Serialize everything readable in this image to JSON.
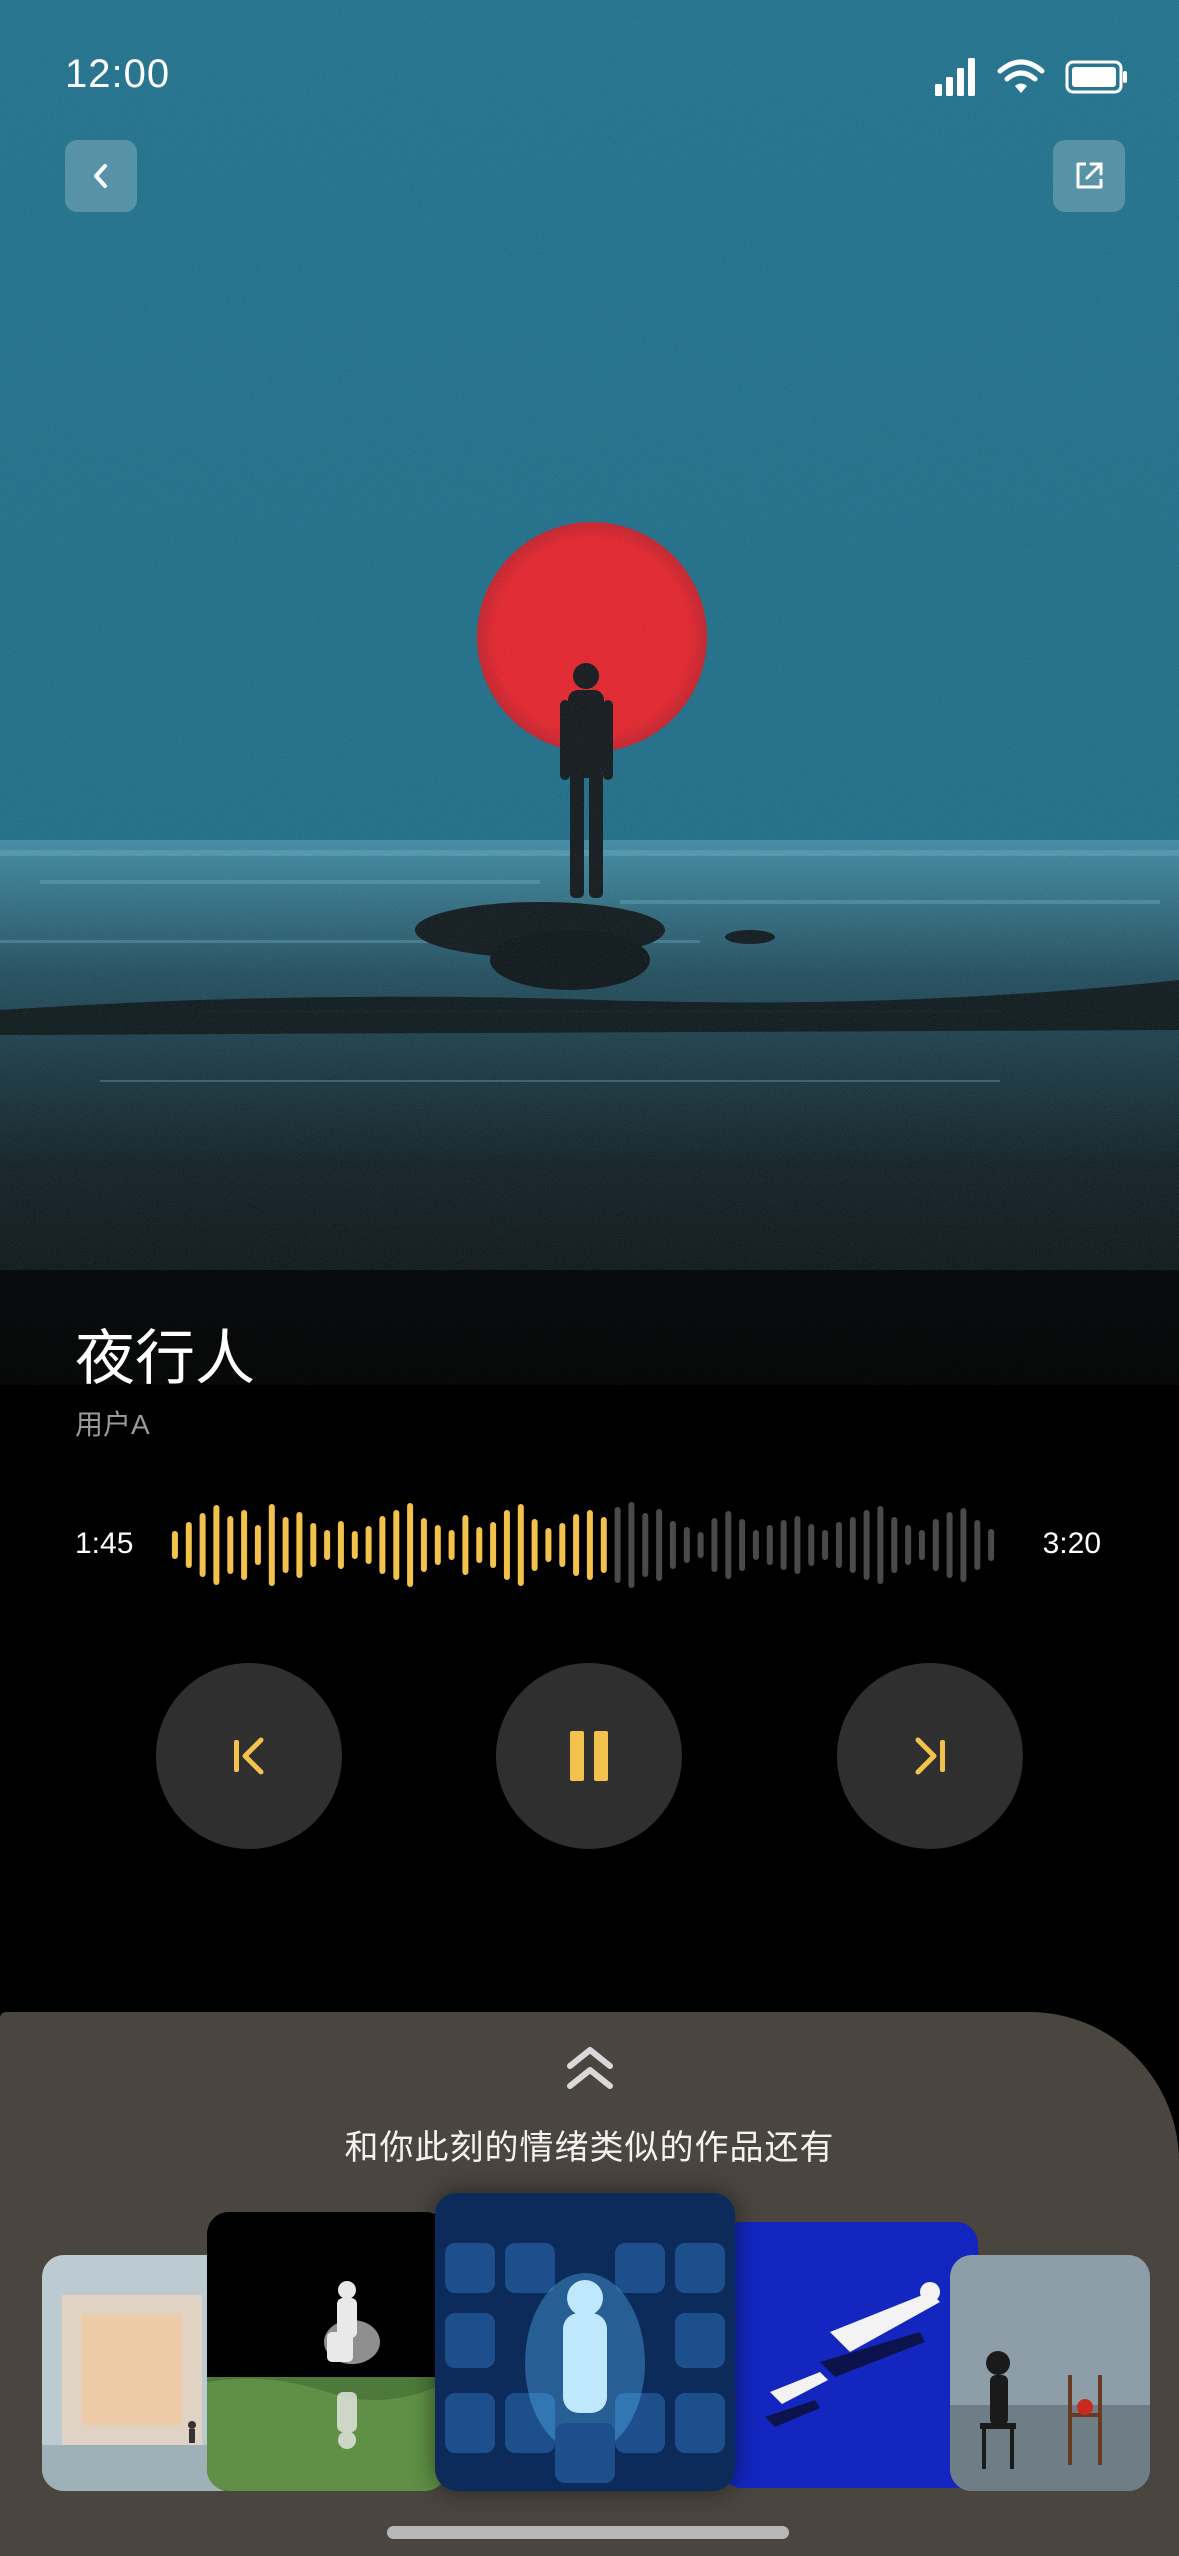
{
  "status_bar": {
    "time": "12:00"
  },
  "song": {
    "title": "夜行人",
    "artist": "用户A"
  },
  "progress": {
    "current": "1:45",
    "total": "3:20",
    "played_fraction": 0.525
  },
  "colors": {
    "accent": "#f3c24c",
    "sheet_bg": "#4a453f",
    "control_bg": "#2f2f2f"
  },
  "icons": {
    "back": "chevron-left-icon",
    "share": "external-link-icon",
    "prev": "skip-previous-icon",
    "play": "pause-icon",
    "next": "skip-next-icon",
    "expand": "double-chevron-up-icon"
  },
  "recommendations": {
    "heading": "和你此刻的情绪类似的作品还有",
    "items": [
      "artwork-1",
      "artwork-2",
      "artwork-3",
      "artwork-4",
      "artwork-5"
    ]
  }
}
